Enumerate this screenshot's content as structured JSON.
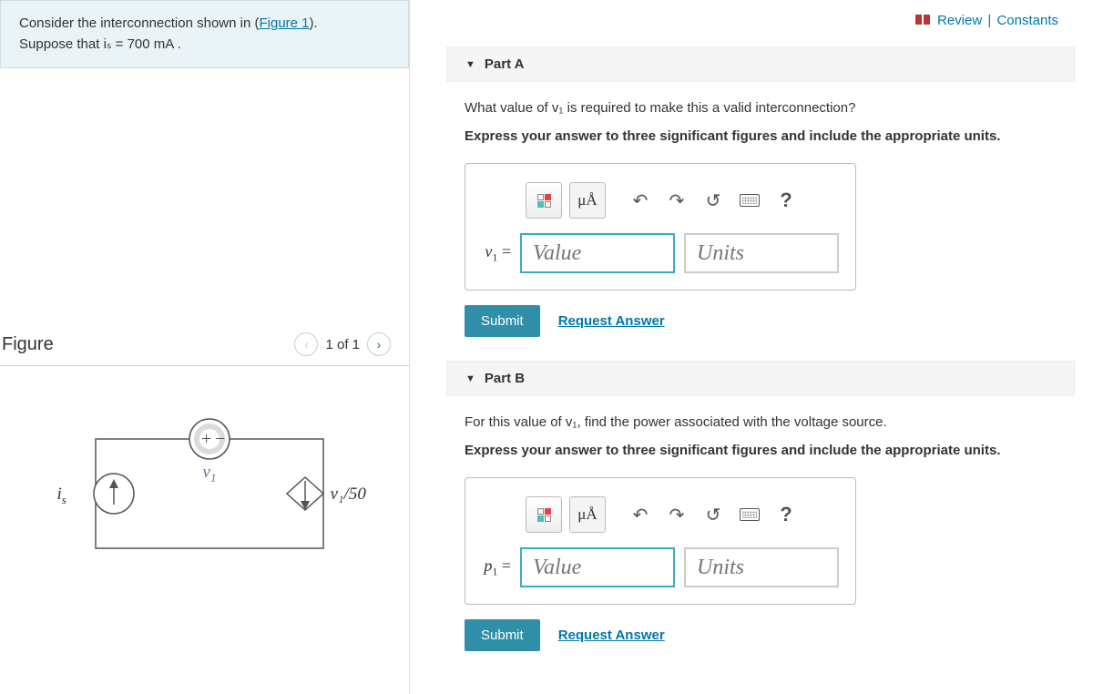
{
  "top_links": {
    "review": "Review",
    "constants": "Constants"
  },
  "problem": {
    "line1_prefix": "Consider the interconnection shown in (",
    "figure_link": "Figure 1",
    "line1_suffix": ").",
    "line2": "Suppose that iₛ = 700 mA ."
  },
  "figure": {
    "title": "Figure",
    "count": "1 of 1",
    "labels": {
      "is": "i",
      "is_sub": "s",
      "v1": "v",
      "v1_sub": "1",
      "dep": "v₁/50"
    }
  },
  "part_a": {
    "title": "Part A",
    "question_html": "What value of v₁ is required to make this a valid interconnection?",
    "instruction": "Express your answer to three significant figures and include the appropriate units.",
    "var_label": "v",
    "var_sub": "1",
    "eq": " =",
    "value_placeholder": "Value",
    "units_placeholder": "Units",
    "units_btn": "μÅ",
    "submit": "Submit",
    "request": "Request Answer"
  },
  "part_b": {
    "title": "Part B",
    "question_html": "For this value of v₁, find the power associated with the voltage source.",
    "instruction": "Express your answer to three significant figures and include the appropriate units.",
    "var_label": "p",
    "var_sub": "1",
    "eq": " =",
    "value_placeholder": "Value",
    "units_placeholder": "Units",
    "units_btn": "μÅ",
    "submit": "Submit",
    "request": "Request Answer"
  },
  "help_label": "?"
}
